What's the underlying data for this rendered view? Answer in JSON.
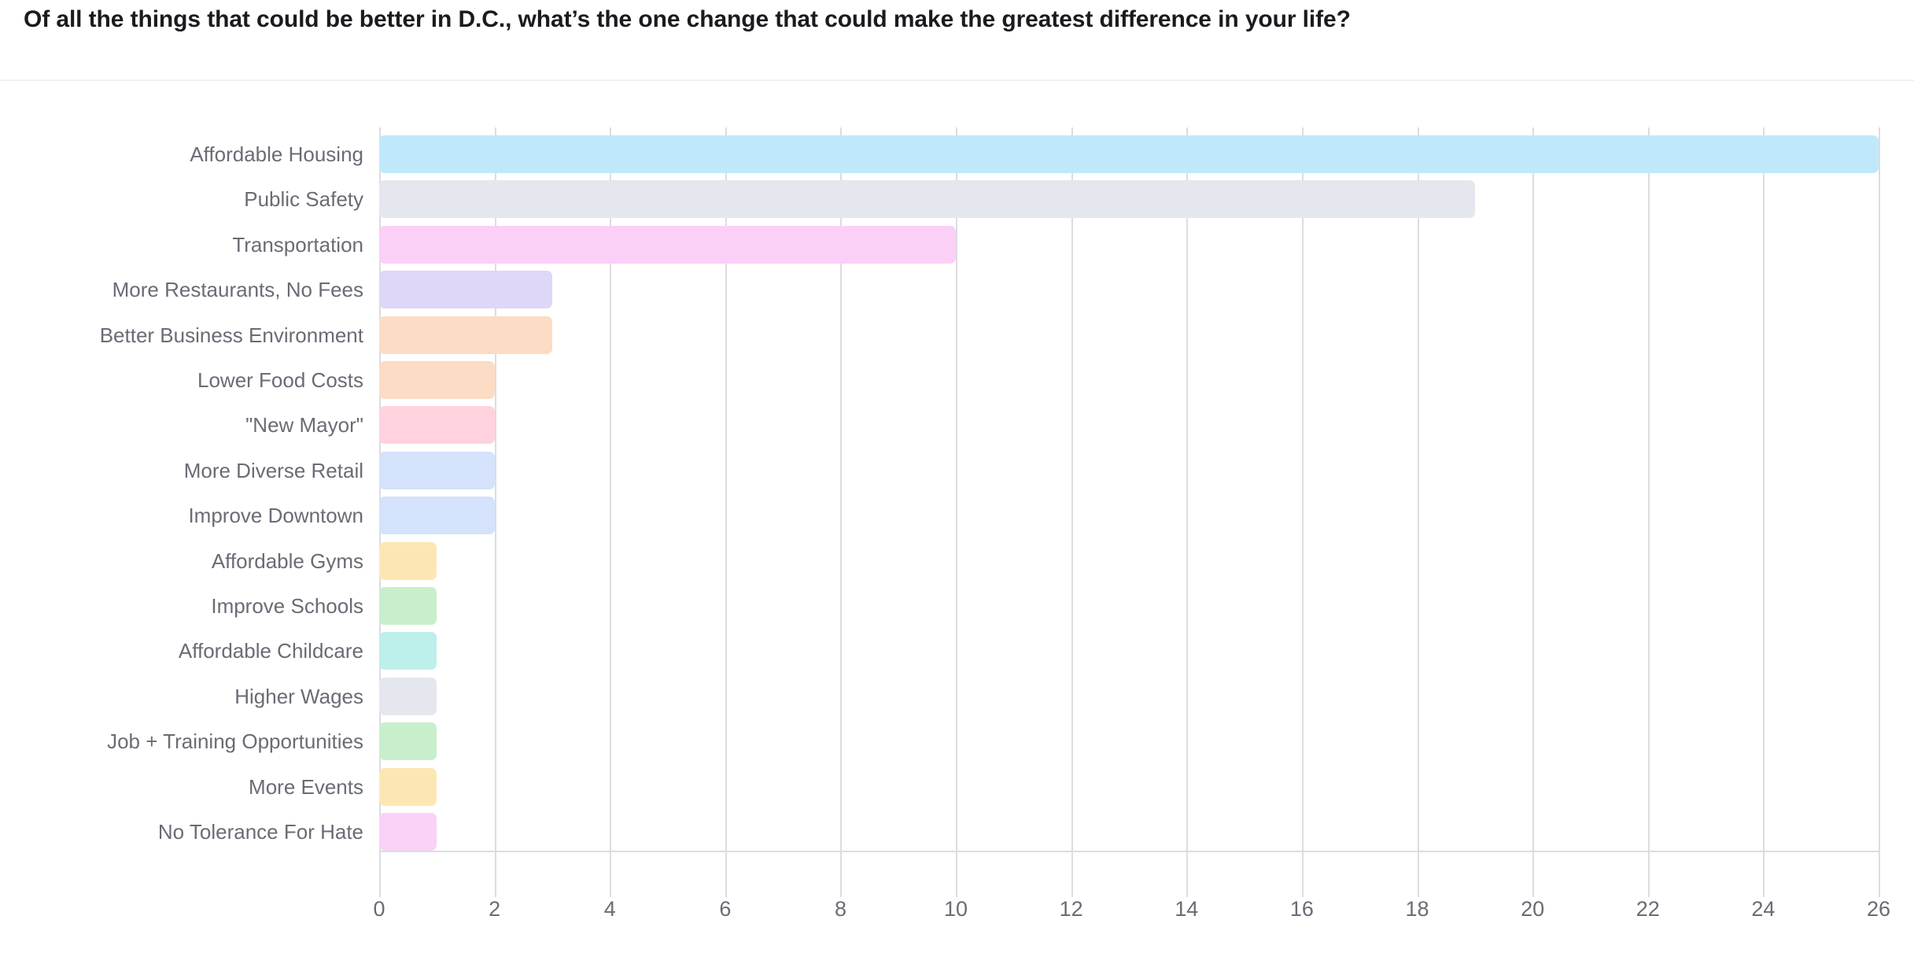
{
  "header": {
    "title": "Of all the things that could be better in D.C., what’s the one change that could make the greatest difference in your life?"
  },
  "axis": {
    "ticks": [
      "0",
      "2",
      "4",
      "6",
      "8",
      "10",
      "12",
      "14",
      "16",
      "18",
      "20",
      "22",
      "24",
      "26"
    ]
  },
  "chart_data": {
    "type": "bar",
    "orientation": "horizontal",
    "title": "Of all the things that could be better in D.C., what’s the one change that could make the greatest difference in your life?",
    "xlabel": "",
    "ylabel": "",
    "xlim": [
      0,
      26
    ],
    "xticks": [
      0,
      2,
      4,
      6,
      8,
      10,
      12,
      14,
      16,
      18,
      20,
      22,
      24,
      26
    ],
    "grid": "vertical",
    "legend": "none",
    "categories": [
      "Affordable Housing",
      "Public Safety",
      "Transportation",
      "More Restaurants, No Fees",
      "Better Business Environment",
      "Lower Food Costs",
      "\"New Mayor\"",
      "More Diverse Retail",
      "Improve Downtown",
      "Affordable Gyms",
      "Improve Schools",
      "Affordable Childcare",
      "Higher Wages",
      "Job + Training Opportunities",
      "More Events",
      "No Tolerance For Hate"
    ],
    "values": [
      26,
      19,
      10,
      3,
      3,
      2,
      2,
      2,
      2,
      1,
      1,
      1,
      1,
      1,
      1,
      1
    ],
    "colors": [
      "#bfe9fb",
      "#e4e7ed",
      "#fad0f7",
      "#ded7f7",
      "#fcdcc4",
      "#fcdcc4",
      "#ffd2dd",
      "#d4e2fb",
      "#d4e2fb",
      "#fce7b4",
      "#c8efcb",
      "#bdefeb",
      "#e4e7ed",
      "#c8efcb",
      "#fce7b4",
      "#f8d2f8"
    ]
  }
}
